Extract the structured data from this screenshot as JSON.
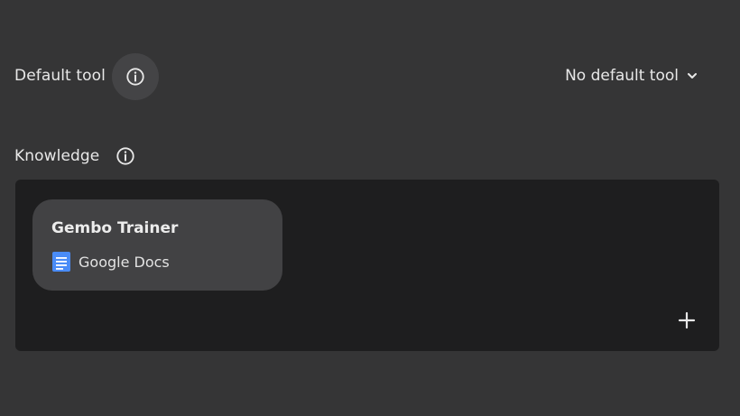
{
  "default_tool": {
    "label": "Default tool",
    "info_icon": "info-icon",
    "dropdown": {
      "selected": "No default tool",
      "icon": "chevron-down-icon"
    }
  },
  "knowledge": {
    "label": "Knowledge",
    "info_icon": "info-icon",
    "items": [
      {
        "title": "Gembo Trainer",
        "source": "Google Docs",
        "source_icon": "google-docs-icon"
      }
    ],
    "add_icon": "plus-icon"
  },
  "colors": {
    "background": "#353536",
    "panel": "#1e1e1f",
    "card": "#424244",
    "google_docs_blue": "#4a8cf7"
  }
}
